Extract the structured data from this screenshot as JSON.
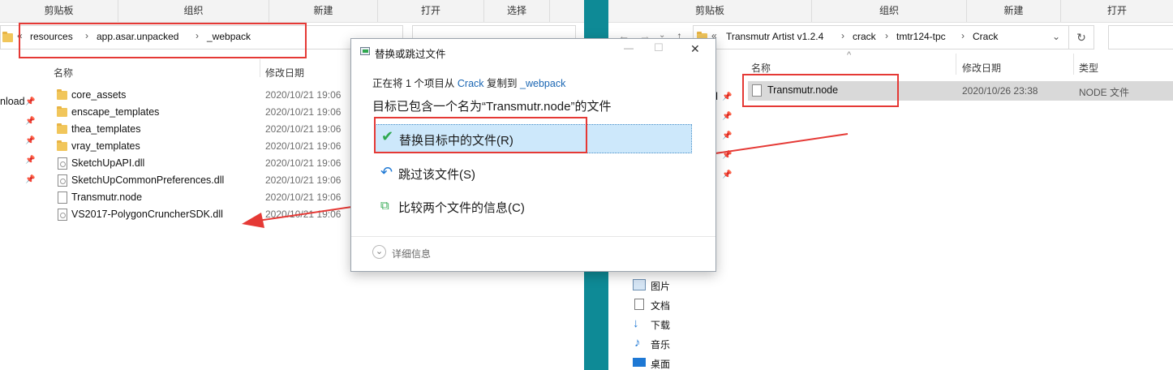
{
  "left_window": {
    "ribbon": [
      "剪贴板",
      "组织",
      "新建",
      "打开",
      "选择"
    ],
    "breadcrumb_root": "«",
    "breadcrumb": [
      "resources",
      "app.asar.unpacked",
      "_webpack"
    ],
    "columns": {
      "name": "名称",
      "date": "修改日期"
    },
    "sidebar_partial": "nload",
    "files": [
      {
        "name": "core_assets",
        "date": "2020/10/21 19:06",
        "kind": "folder"
      },
      {
        "name": "enscape_templates",
        "date": "2020/10/21 19:06",
        "kind": "folder"
      },
      {
        "name": "thea_templates",
        "date": "2020/10/21 19:06",
        "kind": "folder"
      },
      {
        "name": "vray_templates",
        "date": "2020/10/21 19:06",
        "kind": "folder"
      },
      {
        "name": "SketchUpAPI.dll",
        "date": "2020/10/21 19:06",
        "kind": "dll"
      },
      {
        "name": "SketchUpCommonPreferences.dll",
        "date": "2020/10/21 19:06",
        "kind": "dll"
      },
      {
        "name": "Transmutr.node",
        "date": "2020/10/21 19:06",
        "kind": "file"
      },
      {
        "name": "VS2017-PolygonCruncherSDK.dll",
        "date": "2020/10/21 19:06",
        "kind": "dll"
      }
    ]
  },
  "right_window": {
    "ribbon": [
      "剪贴板",
      "组织",
      "新建",
      "打开"
    ],
    "breadcrumb_root": "«",
    "breadcrumb": [
      "Transmutr Artist v1.2.4",
      "crack",
      "tmtr124-tpc",
      "Crack"
    ],
    "columns": {
      "name": "名称",
      "date": "修改日期",
      "type": "类型"
    },
    "sidebar_partial": "d",
    "file": {
      "name": "Transmutr.node",
      "date": "2020/10/26 23:38",
      "type": "NODE 文件"
    },
    "nav": [
      "图片",
      "文档",
      "下载",
      "音乐",
      "桌面"
    ]
  },
  "dialog": {
    "title": "替换或跳过文件",
    "status_prefix": "正在将 1 个项目从",
    "status_source": "Crack",
    "status_mid": "复制到",
    "status_dest": "_webpack",
    "heading": "目标已包含一个名为“Transmutr.node”的文件",
    "options": {
      "replace": "替换目标中的文件(R)",
      "skip": "跳过该文件(S)",
      "compare": "比较两个文件的信息(C)"
    },
    "details": "详细信息",
    "minimize_glyph": "—",
    "maximize_glyph": "☐",
    "close_glyph": "✕"
  },
  "colors": {
    "highlight_red": "#e53935",
    "teal_gap": "#0e8a96",
    "link_blue": "#1a66b3",
    "selected_option": "#cde8fb"
  }
}
